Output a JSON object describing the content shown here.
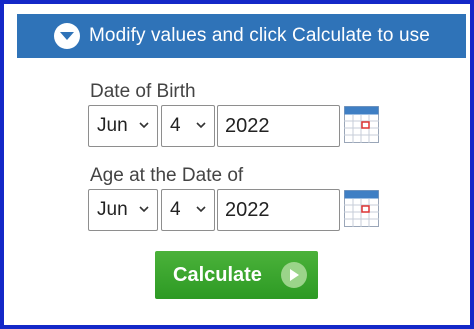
{
  "header": {
    "title": "Modify values and click Calculate to use",
    "icon": "chevron-down-circle-icon",
    "color": "#2f73b8"
  },
  "date_of_birth": {
    "label": "Date of Birth",
    "month": "Jun",
    "day": "4",
    "year": "2022"
  },
  "age_at_date": {
    "label": "Age at the Date of",
    "month": "Jun",
    "day": "4",
    "year": "2022"
  },
  "calculate": {
    "label": "Calculate",
    "color": "#3aa82e"
  },
  "frame_color": "#1428c8"
}
